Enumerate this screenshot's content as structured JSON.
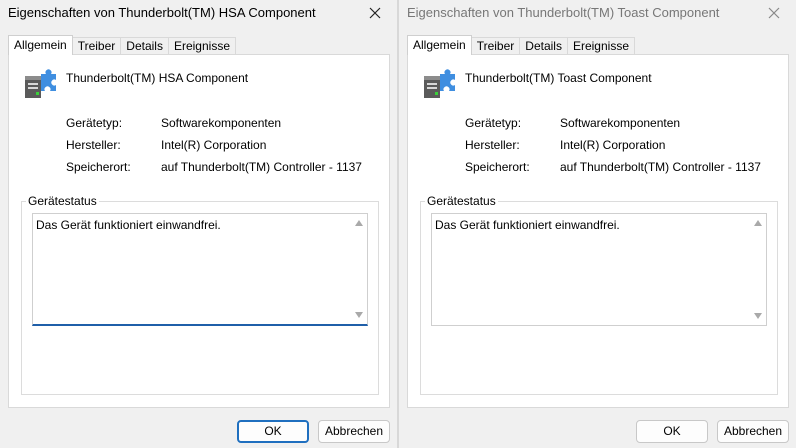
{
  "left_dialog": {
    "title": "Eigenschaften von Thunderbolt(TM) HSA Component",
    "tabs": [
      {
        "label": "Allgemein",
        "active": true
      },
      {
        "label": "Treiber",
        "active": false
      },
      {
        "label": "Details",
        "active": false
      },
      {
        "label": "Ereignisse",
        "active": false
      }
    ],
    "device_name": "Thunderbolt(TM) HSA Component",
    "properties": [
      {
        "label": "Gerätetyp:",
        "value": "Softwarekomponenten"
      },
      {
        "label": "Hersteller:",
        "value": "Intel(R) Corporation"
      },
      {
        "label": "Speicherort:",
        "value": "auf Thunderbolt(TM) Controller - 1137"
      }
    ],
    "status_legend": "Gerätestatus",
    "status_text": "Das Gerät funktioniert einwandfrei.",
    "ok_label": "OK",
    "cancel_label": "Abbrechen"
  },
  "right_dialog": {
    "title": "Eigenschaften von Thunderbolt(TM) Toast Component",
    "tabs": [
      {
        "label": "Allgemein",
        "active": true
      },
      {
        "label": "Treiber",
        "active": false
      },
      {
        "label": "Details",
        "active": false
      },
      {
        "label": "Ereignisse",
        "active": false
      }
    ],
    "device_name": "Thunderbolt(TM) Toast Component",
    "properties": [
      {
        "label": "Gerätetyp:",
        "value": "Softwarekomponenten"
      },
      {
        "label": "Hersteller:",
        "value": "Intel(R) Corporation"
      },
      {
        "label": "Speicherort:",
        "value": "auf Thunderbolt(TM) Controller - 1137"
      }
    ],
    "status_legend": "Gerätestatus",
    "status_text": "Das Gerät funktioniert einwandfrei.",
    "ok_label": "OK",
    "cancel_label": "Abbrechen"
  },
  "icons": {
    "device": "puzzle-device-icon",
    "close": "close-icon",
    "scroll_up": "scroll-up-arrow-icon",
    "scroll_down": "scroll-down-arrow-icon"
  },
  "colors": {
    "accent": "#1f6fbf",
    "focus_underline": "#1f5fa9",
    "icon_puzzle": "#3f8ee0"
  }
}
